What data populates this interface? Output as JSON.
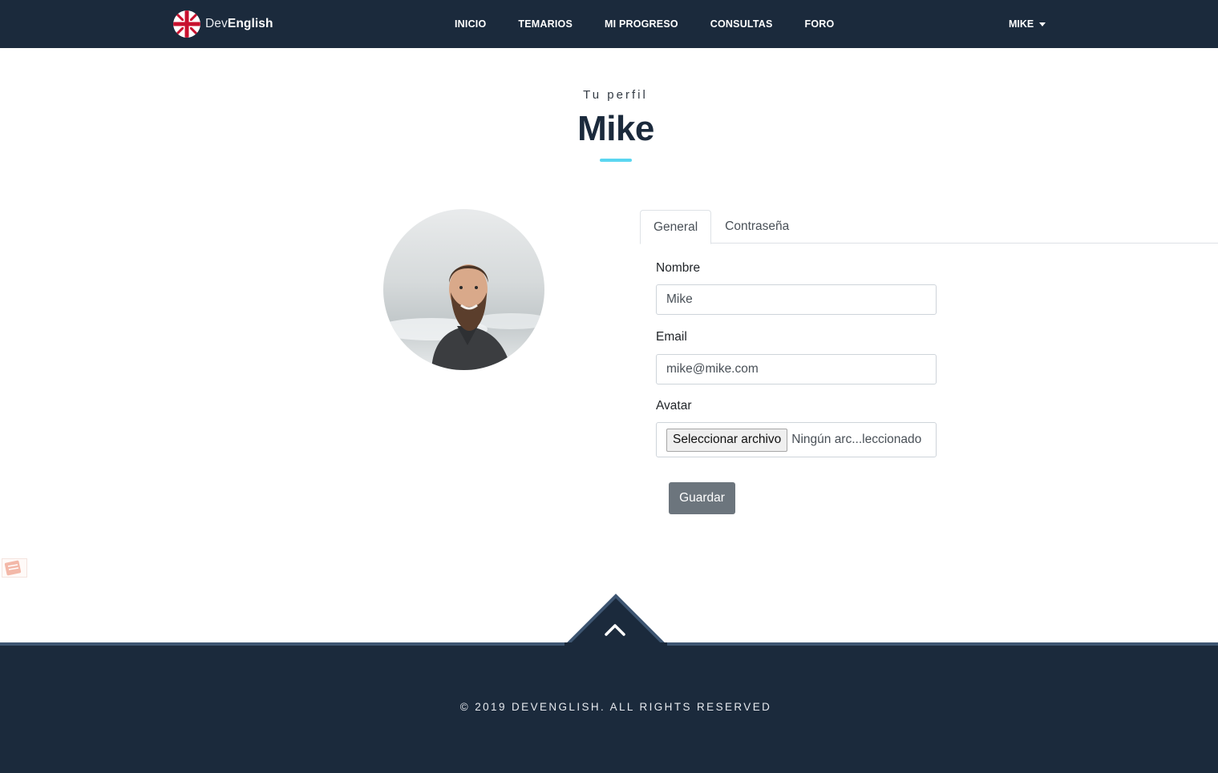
{
  "brand": {
    "name_light": "Dev",
    "name_bold": "English"
  },
  "nav": {
    "links": [
      "INICIO",
      "TEMARIOS",
      "MI PROGRESO",
      "CONSULTAS",
      "FORO"
    ],
    "user": "MIKE"
  },
  "profile": {
    "subtitle": "Tu perfil",
    "title": "Mike"
  },
  "tabs": [
    {
      "label": "General",
      "active": true
    },
    {
      "label": "Contraseña",
      "active": false
    }
  ],
  "form": {
    "name_label": "Nombre",
    "name_value": "Mike",
    "email_label": "Email",
    "email_value": "mike@mike.com",
    "avatar_label": "Avatar",
    "file_button": "Seleccionar archivo",
    "file_status": "Ningún arc...leccionado",
    "save_label": "Guardar"
  },
  "footer": {
    "copyright": "© 2019 DEVENGLISH. ALL RIGHTS RESERVED"
  },
  "colors": {
    "navbar": "#1b2a3c",
    "accent": "#5ad6f0",
    "footer_border": "#3e5672",
    "button": "#6c757d"
  }
}
